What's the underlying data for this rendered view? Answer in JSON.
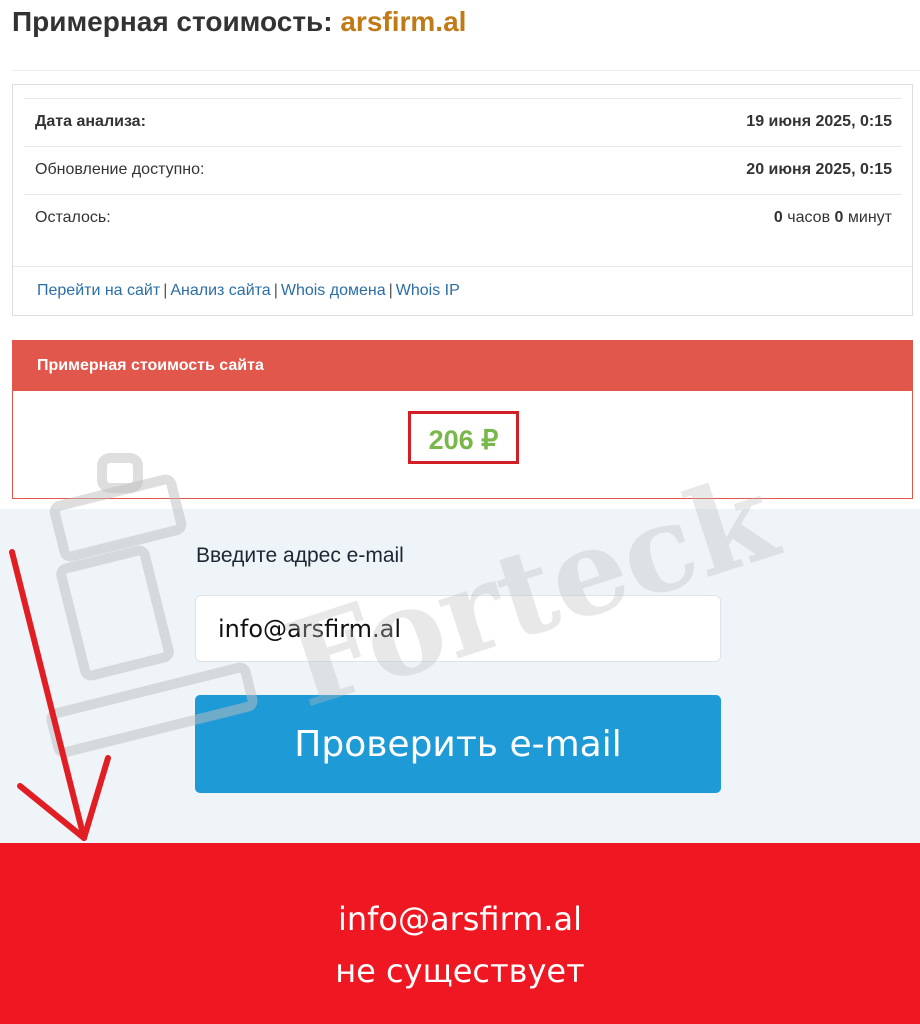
{
  "heading": {
    "prefix": "Примерная стоимость:",
    "domain": "arsfirm.al"
  },
  "analysis": {
    "rows": [
      {
        "label": "Дата анализа:",
        "value": "19 июня 2025, 0:15"
      },
      {
        "label": "Обновление доступно:",
        "value": "20 июня 2025, 0:15"
      },
      {
        "label": "Осталось:",
        "hours": "0",
        "hours_unit": "часов",
        "minutes": "0",
        "minutes_unit": "минут"
      }
    ],
    "links": [
      "Перейти на сайт",
      "Анализ сайта",
      "Whois домена",
      "Whois IP"
    ],
    "separator": "|"
  },
  "price": {
    "title": "Примерная стоимость сайта",
    "value": "206 ₽"
  },
  "email_form": {
    "label": "Введите адрес e-mail",
    "value": "info@arsfirm.al",
    "button_label": "Проверить e-mail"
  },
  "result": {
    "line1": "info@arsfirm.al",
    "line2": "не существует"
  },
  "watermark": {
    "text": "Forteck"
  },
  "colors": {
    "domain": "#c07a16",
    "price_header": "#e2574c",
    "price_value": "#79b74a",
    "highlight_border": "#d21f26",
    "button": "#1e9ad6",
    "result_banner": "#ee1722",
    "annotation_arrow": "#e01e24"
  }
}
